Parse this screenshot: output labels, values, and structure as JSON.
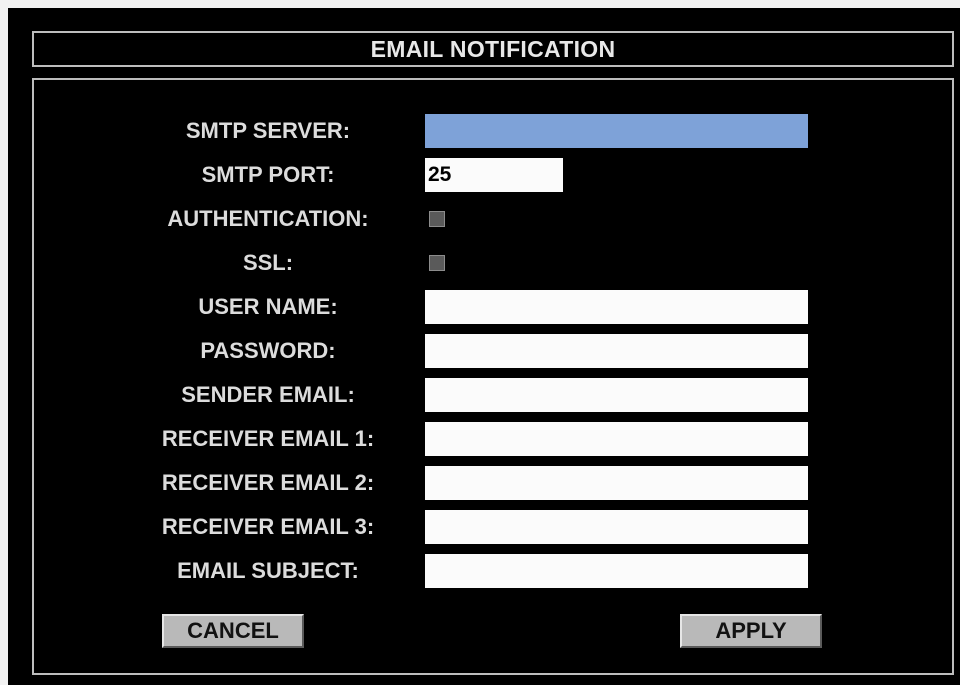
{
  "title": "EMAIL NOTIFICATION",
  "fields": {
    "smtp_server": {
      "label": "SMTP SERVER:",
      "value": ""
    },
    "smtp_port": {
      "label": "SMTP PORT:",
      "value": "25"
    },
    "authentication": {
      "label": "AUTHENTICATION:",
      "checked": false
    },
    "ssl": {
      "label": "SSL:",
      "checked": false
    },
    "user_name": {
      "label": "USER NAME:",
      "value": ""
    },
    "password": {
      "label": "PASSWORD:",
      "value": ""
    },
    "sender_email": {
      "label": "SENDER EMAIL:",
      "value": ""
    },
    "receiver_email_1": {
      "label": "RECEIVER EMAIL 1:",
      "value": ""
    },
    "receiver_email_2": {
      "label": "RECEIVER EMAIL 2:",
      "value": ""
    },
    "receiver_email_3": {
      "label": "RECEIVER EMAIL 3:",
      "value": ""
    },
    "email_subject": {
      "label": "EMAIL SUBJECT:",
      "value": ""
    }
  },
  "buttons": {
    "cancel": "CANCEL",
    "apply": "APPLY"
  },
  "colors": {
    "background": "#000000",
    "text": "#dcdcdc",
    "border": "#bdbdbd",
    "selected_field": "#7ea2d8",
    "field": "#fbfbfb",
    "button": "#b9b9b9"
  }
}
